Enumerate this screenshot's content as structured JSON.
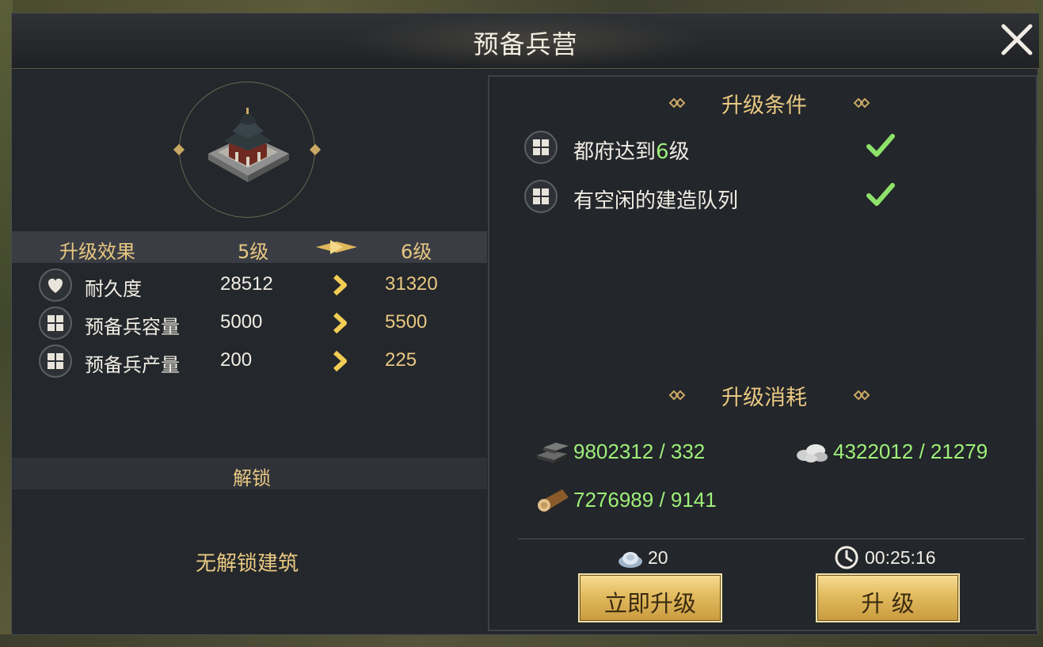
{
  "dialog": {
    "title": "预备兵营"
  },
  "effects": {
    "header_label": "升级效果",
    "current_level": "5级",
    "next_level": "6级",
    "rows": [
      {
        "icon": "heart-icon",
        "name": "耐久度",
        "current": "28512",
        "next": "31320"
      },
      {
        "icon": "grid-icon",
        "name": "预备兵容量",
        "current": "5000",
        "next": "5500"
      },
      {
        "icon": "grid-icon",
        "name": "预备兵产量",
        "current": "200",
        "next": "225"
      }
    ]
  },
  "unlock": {
    "title": "解锁",
    "empty_text": "无解锁建筑"
  },
  "conditions": {
    "title": "升级条件",
    "items": [
      {
        "text_pre": "都府达到",
        "text_hl": "6",
        "text_post": "级",
        "met": true
      },
      {
        "text_pre": "有空闲的建造队列",
        "text_hl": "",
        "text_post": "",
        "met": true
      }
    ]
  },
  "cost": {
    "title": "升级消耗",
    "resources": [
      {
        "icon": "iron-ingot-icon",
        "text": "9802312 / 332"
      },
      {
        "icon": "stone-icon",
        "text": "4322012 / 21279"
      },
      {
        "icon": "wood-log-icon",
        "text": "7276989 / 9141"
      }
    ]
  },
  "footer": {
    "gems": "20",
    "time": "00:25:16",
    "instant_button": "立即升级",
    "upgrade_button": "升 级"
  },
  "colors": {
    "gold_text": "#e8c882",
    "green_text": "#9ef07a",
    "panel_bg": "#24272b",
    "button_gold": "#e2bb5f"
  }
}
